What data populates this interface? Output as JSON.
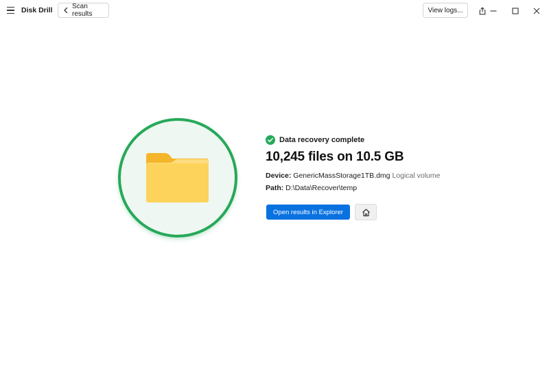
{
  "app": {
    "title": "Disk Drill"
  },
  "toolbar": {
    "back_label": "Scan results",
    "view_logs_label": "View logs..."
  },
  "result": {
    "status": "Data recovery complete",
    "headline": "10,245 files on 10.5 GB",
    "device_label": "Device:",
    "device_value": "GenericMassStorage1TB.dmg",
    "device_type": "Logical volume",
    "path_label": "Path:",
    "path_value": "D:\\Data\\Recover\\temp",
    "open_button_label": "Open results in Explorer"
  },
  "icons": {
    "menu": "hamburger-icon",
    "back": "chevron-left-icon",
    "share": "share-icon",
    "minimize": "minimize-icon",
    "maximize": "maximize-icon",
    "close": "close-icon",
    "status": "check-circle-icon",
    "folder": "folder-icon",
    "home": "home-icon"
  },
  "colors": {
    "accent": "#0a72e0",
    "success": "#27a85a",
    "circle_fill": "#eef7f1",
    "folder_front": "#fdd35b",
    "folder_back": "#f5b52a"
  }
}
